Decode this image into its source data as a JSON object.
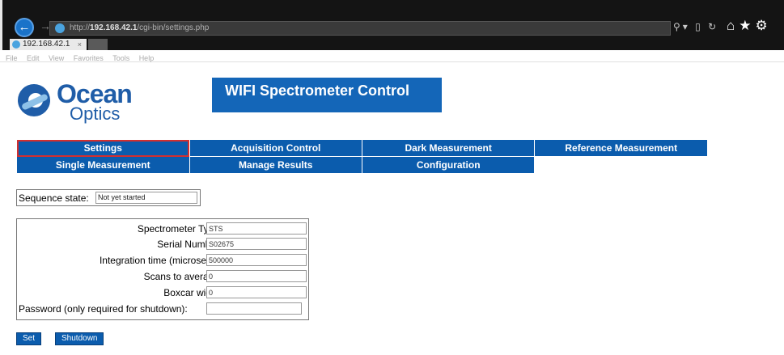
{
  "browser": {
    "url_prefix": "http://",
    "url_host": "192.168.42.1",
    "url_path": "/cgi-bin/settings.php",
    "tab_title": "192.168.42.1",
    "tab_close": "×",
    "back_glyph": "←",
    "forward_glyph": "→",
    "search_tools": "⚲▾ ▯ ↻",
    "toolbar_icons": "⌂★⚙",
    "menu": [
      "File",
      "Edit",
      "View",
      "Favorites",
      "Tools",
      "Help"
    ]
  },
  "logo": {
    "line1": "Ocean",
    "line2": "Optics",
    "color": "#1f5da8"
  },
  "banner": {
    "title": "WIFI Spectrometer Control",
    "color": "#1466b8"
  },
  "nav": {
    "row1": [
      "Settings",
      "Acquisition Control",
      "Dark Measurement",
      "Reference Measurement"
    ],
    "row2": [
      "Single Measurement",
      "Manage Results",
      "Configuration"
    ],
    "active": "Settings",
    "color": "#0b5cad",
    "active_outline": "#d32f2f"
  },
  "sequence": {
    "label": "Sequence state:",
    "value": "Not yet started"
  },
  "settings": {
    "spectrometer_type": {
      "label": "Spectrometer Type",
      "value": "STS"
    },
    "serial_number": {
      "label": "Serial Number",
      "value": "S02675"
    },
    "integration_time": {
      "label": "Integration time (microsecs)",
      "value": "500000"
    },
    "scans_to_average": {
      "label": "Scans to average",
      "value": "0"
    },
    "boxcar_width": {
      "label": "Boxcar width",
      "value": "0"
    },
    "password": {
      "label": "Password (only required for shutdown):",
      "value": ""
    }
  },
  "buttons": {
    "set": "Set",
    "shutdown": "Shutdown"
  }
}
